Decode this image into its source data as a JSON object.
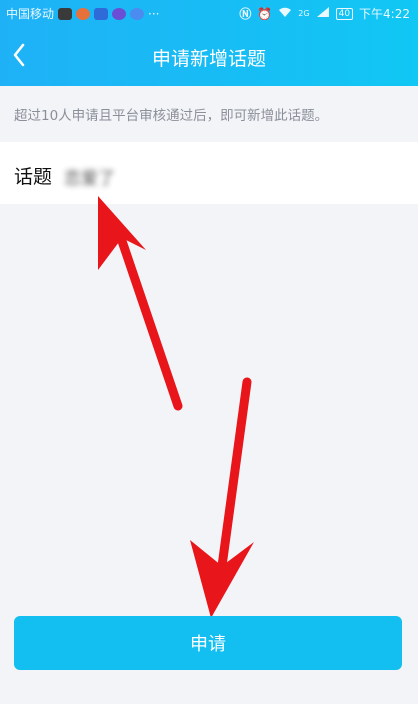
{
  "status_bar": {
    "carrier": "中国移动",
    "more": "···",
    "network": "2G",
    "battery": "40",
    "time": "下午4:22"
  },
  "header": {
    "title": "申请新增话题"
  },
  "hint": "超过10人申请且平台审核通过后，即可新增此话题。",
  "topic": {
    "label": "话题",
    "value": "恋爱了"
  },
  "submit_label": "申请",
  "colors": {
    "header_start": "#1fb1f6",
    "header_end": "#11c7f4",
    "button": "#12bff0",
    "background": "#f3f4f8",
    "arrow": "#e8161b"
  }
}
